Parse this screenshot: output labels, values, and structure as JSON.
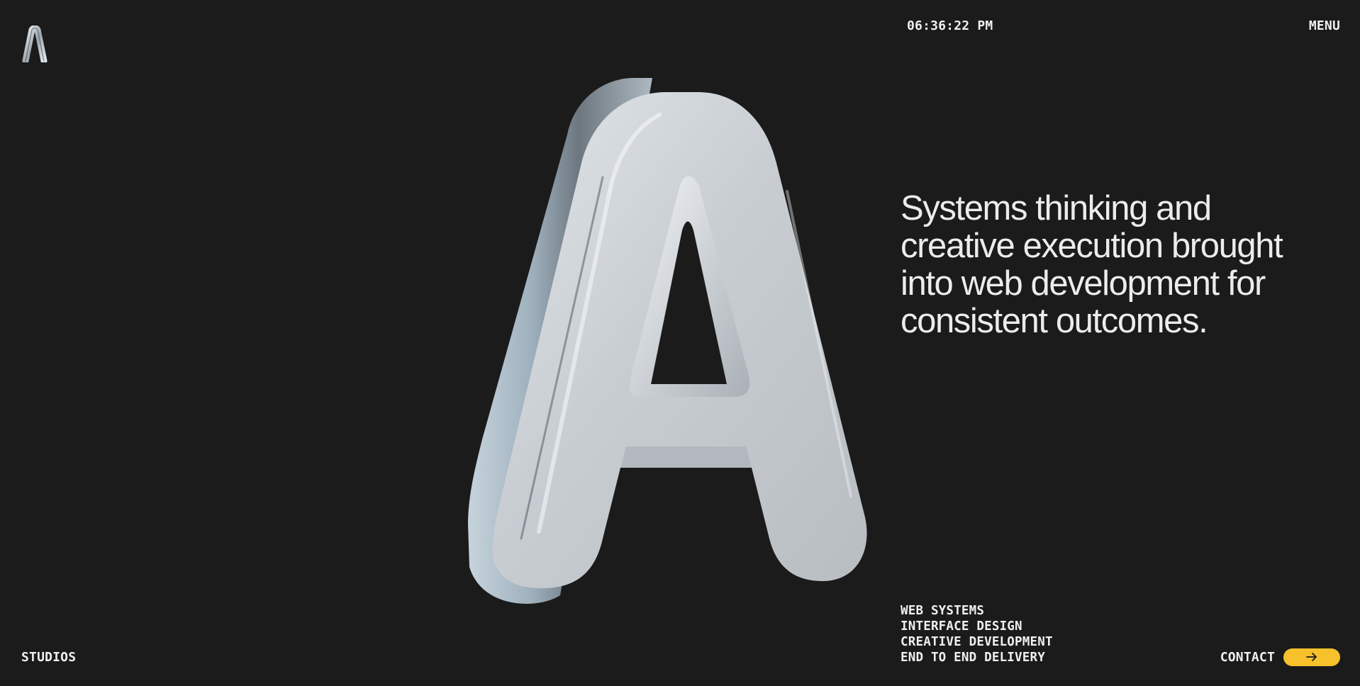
{
  "header": {
    "clock": "06:36:22 PM",
    "menu_label": "MENU"
  },
  "hero": {
    "headline": "Systems thinking and creative execution brought into web development for consistent outcomes."
  },
  "services": [
    "WEB SYSTEMS",
    "INTERFACE DESIGN",
    "CREATIVE DEVELOPMENT",
    "END TO END DELIVERY"
  ],
  "footer": {
    "studios_label": "STUDIOS",
    "contact_label": "CONTACT"
  },
  "icons": {
    "logo": "letter-a-logo-icon",
    "contact_arrow": "arrow-right-icon",
    "hero": "chrome-letter-a-3d-render"
  },
  "colors": {
    "background": "#1b1b1b",
    "text": "#ececec",
    "accent": "#f6c12b"
  }
}
